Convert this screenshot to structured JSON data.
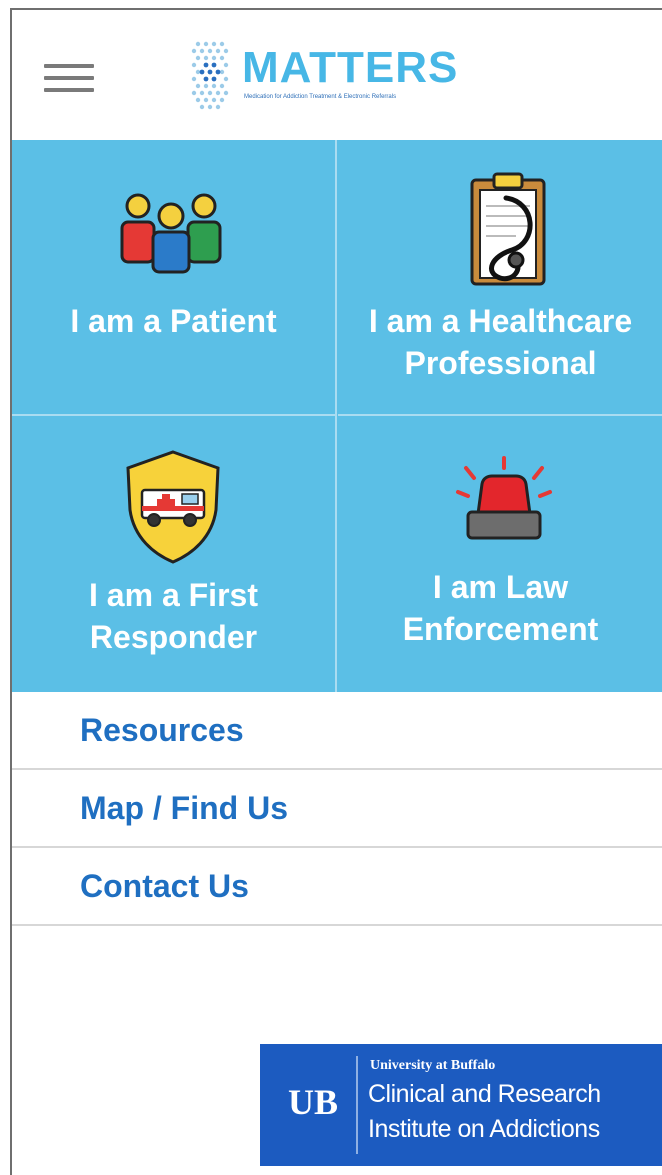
{
  "header": {
    "menu_icon": "hamburger-menu-icon",
    "logo": {
      "title": "MATTERS",
      "tagline": "Medication for Addiction Treatment & Electronic Referrals",
      "mark_icon": "hexagon-dots-icon"
    }
  },
  "tiles": [
    {
      "label_line1": "I am a Patient",
      "label_line2": "",
      "icon": "people-group-icon"
    },
    {
      "label_line1": "I am a Healthcare",
      "label_line2": "Professional",
      "icon": "clipboard-stethoscope-icon"
    },
    {
      "label_line1": "I am a First",
      "label_line2": "Responder",
      "icon": "ambulance-shield-icon"
    },
    {
      "label_line1": "I am Law",
      "label_line2": "Enforcement",
      "icon": "police-siren-icon"
    }
  ],
  "links": [
    {
      "label": "Resources"
    },
    {
      "label": "Map / Find Us"
    },
    {
      "label": "Contact Us"
    }
  ],
  "footer_badge": {
    "university": "University at Buffalo",
    "line1": "Clinical and Research",
    "line2": "Institute on Addictions",
    "mark": "UB"
  },
  "colors": {
    "tile_background": "#5bbfe6",
    "link_text": "#1f6fc1",
    "logo_blue": "#47b7e6",
    "badge_background": "#1c5bc0"
  }
}
